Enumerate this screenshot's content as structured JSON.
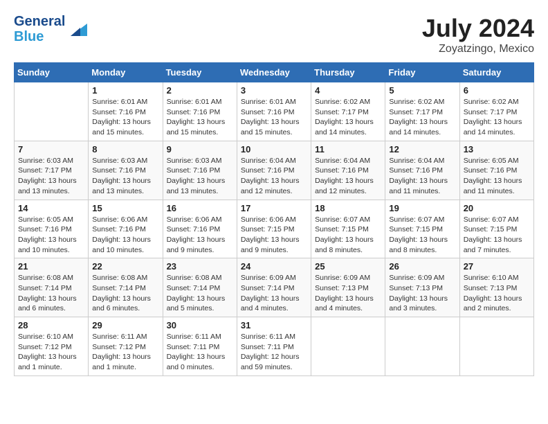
{
  "header": {
    "logo_line1": "General",
    "logo_line2": "Blue",
    "month_year": "July 2024",
    "location": "Zoyatzingo, Mexico"
  },
  "weekdays": [
    "Sunday",
    "Monday",
    "Tuesday",
    "Wednesday",
    "Thursday",
    "Friday",
    "Saturday"
  ],
  "weeks": [
    [
      {
        "day": "",
        "info": ""
      },
      {
        "day": "1",
        "info": "Sunrise: 6:01 AM\nSunset: 7:16 PM\nDaylight: 13 hours\nand 15 minutes."
      },
      {
        "day": "2",
        "info": "Sunrise: 6:01 AM\nSunset: 7:16 PM\nDaylight: 13 hours\nand 15 minutes."
      },
      {
        "day": "3",
        "info": "Sunrise: 6:01 AM\nSunset: 7:16 PM\nDaylight: 13 hours\nand 15 minutes."
      },
      {
        "day": "4",
        "info": "Sunrise: 6:02 AM\nSunset: 7:17 PM\nDaylight: 13 hours\nand 14 minutes."
      },
      {
        "day": "5",
        "info": "Sunrise: 6:02 AM\nSunset: 7:17 PM\nDaylight: 13 hours\nand 14 minutes."
      },
      {
        "day": "6",
        "info": "Sunrise: 6:02 AM\nSunset: 7:17 PM\nDaylight: 13 hours\nand 14 minutes."
      }
    ],
    [
      {
        "day": "7",
        "info": "Sunrise: 6:03 AM\nSunset: 7:17 PM\nDaylight: 13 hours\nand 13 minutes."
      },
      {
        "day": "8",
        "info": "Sunrise: 6:03 AM\nSunset: 7:16 PM\nDaylight: 13 hours\nand 13 minutes."
      },
      {
        "day": "9",
        "info": "Sunrise: 6:03 AM\nSunset: 7:16 PM\nDaylight: 13 hours\nand 13 minutes."
      },
      {
        "day": "10",
        "info": "Sunrise: 6:04 AM\nSunset: 7:16 PM\nDaylight: 13 hours\nand 12 minutes."
      },
      {
        "day": "11",
        "info": "Sunrise: 6:04 AM\nSunset: 7:16 PM\nDaylight: 13 hours\nand 12 minutes."
      },
      {
        "day": "12",
        "info": "Sunrise: 6:04 AM\nSunset: 7:16 PM\nDaylight: 13 hours\nand 11 minutes."
      },
      {
        "day": "13",
        "info": "Sunrise: 6:05 AM\nSunset: 7:16 PM\nDaylight: 13 hours\nand 11 minutes."
      }
    ],
    [
      {
        "day": "14",
        "info": "Sunrise: 6:05 AM\nSunset: 7:16 PM\nDaylight: 13 hours\nand 10 minutes."
      },
      {
        "day": "15",
        "info": "Sunrise: 6:06 AM\nSunset: 7:16 PM\nDaylight: 13 hours\nand 10 minutes."
      },
      {
        "day": "16",
        "info": "Sunrise: 6:06 AM\nSunset: 7:16 PM\nDaylight: 13 hours\nand 9 minutes."
      },
      {
        "day": "17",
        "info": "Sunrise: 6:06 AM\nSunset: 7:15 PM\nDaylight: 13 hours\nand 9 minutes."
      },
      {
        "day": "18",
        "info": "Sunrise: 6:07 AM\nSunset: 7:15 PM\nDaylight: 13 hours\nand 8 minutes."
      },
      {
        "day": "19",
        "info": "Sunrise: 6:07 AM\nSunset: 7:15 PM\nDaylight: 13 hours\nand 8 minutes."
      },
      {
        "day": "20",
        "info": "Sunrise: 6:07 AM\nSunset: 7:15 PM\nDaylight: 13 hours\nand 7 minutes."
      }
    ],
    [
      {
        "day": "21",
        "info": "Sunrise: 6:08 AM\nSunset: 7:14 PM\nDaylight: 13 hours\nand 6 minutes."
      },
      {
        "day": "22",
        "info": "Sunrise: 6:08 AM\nSunset: 7:14 PM\nDaylight: 13 hours\nand 6 minutes."
      },
      {
        "day": "23",
        "info": "Sunrise: 6:08 AM\nSunset: 7:14 PM\nDaylight: 13 hours\nand 5 minutes."
      },
      {
        "day": "24",
        "info": "Sunrise: 6:09 AM\nSunset: 7:14 PM\nDaylight: 13 hours\nand 4 minutes."
      },
      {
        "day": "25",
        "info": "Sunrise: 6:09 AM\nSunset: 7:13 PM\nDaylight: 13 hours\nand 4 minutes."
      },
      {
        "day": "26",
        "info": "Sunrise: 6:09 AM\nSunset: 7:13 PM\nDaylight: 13 hours\nand 3 minutes."
      },
      {
        "day": "27",
        "info": "Sunrise: 6:10 AM\nSunset: 7:13 PM\nDaylight: 13 hours\nand 2 minutes."
      }
    ],
    [
      {
        "day": "28",
        "info": "Sunrise: 6:10 AM\nSunset: 7:12 PM\nDaylight: 13 hours\nand 1 minute."
      },
      {
        "day": "29",
        "info": "Sunrise: 6:11 AM\nSunset: 7:12 PM\nDaylight: 13 hours\nand 1 minute."
      },
      {
        "day": "30",
        "info": "Sunrise: 6:11 AM\nSunset: 7:11 PM\nDaylight: 13 hours\nand 0 minutes."
      },
      {
        "day": "31",
        "info": "Sunrise: 6:11 AM\nSunset: 7:11 PM\nDaylight: 12 hours\nand 59 minutes."
      },
      {
        "day": "",
        "info": ""
      },
      {
        "day": "",
        "info": ""
      },
      {
        "day": "",
        "info": ""
      }
    ]
  ]
}
